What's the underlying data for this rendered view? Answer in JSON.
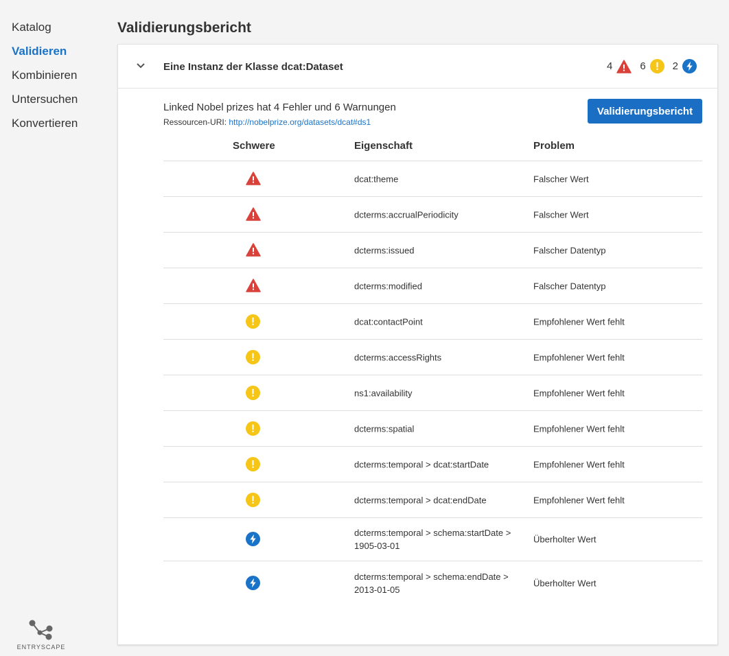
{
  "sidebar": {
    "items": [
      {
        "label": "Katalog"
      },
      {
        "label": "Validieren"
      },
      {
        "label": "Kombinieren"
      },
      {
        "label": "Untersuchen"
      },
      {
        "label": "Konvertieren"
      }
    ],
    "logo_text": "ENTRYSCAPE"
  },
  "page": {
    "title": "Validierungsbericht"
  },
  "card": {
    "title": "Eine Instanz der Klasse dcat:Dataset",
    "counts": {
      "errors": "4",
      "warnings": "6",
      "deprecated": "2"
    },
    "summary": "Linked Nobel prizes hat 4 Fehler und 6 Warnungen",
    "uri_label": "Ressourcen-URI:",
    "uri": "http://nobelprize.org/datasets/dcat#ds1",
    "report_button": "Validierungsbericht"
  },
  "colors": {
    "error": "#d9423a",
    "warning": "#f5c518",
    "deprecated": "#1a73c7",
    "accent": "#1a6fc4"
  },
  "table": {
    "headers": {
      "severity": "Schwere",
      "property": "Eigenschaft",
      "problem": "Problem"
    },
    "rows": [
      {
        "severity": "error-icon",
        "property": "dcat:theme",
        "problem": "Falscher Wert"
      },
      {
        "severity": "error-icon",
        "property": "dcterms:accrualPeriodicity",
        "problem": "Falscher Wert"
      },
      {
        "severity": "error-icon",
        "property": "dcterms:issued",
        "problem": "Falscher Datentyp"
      },
      {
        "severity": "error-icon",
        "property": "dcterms:modified",
        "problem": "Falscher Datentyp"
      },
      {
        "severity": "warning-icon",
        "property": "dcat:contactPoint",
        "problem": "Empfohlener Wert fehlt"
      },
      {
        "severity": "warning-icon",
        "property": "dcterms:accessRights",
        "problem": "Empfohlener Wert fehlt"
      },
      {
        "severity": "warning-icon",
        "property": "ns1:availability",
        "problem": "Empfohlener Wert fehlt"
      },
      {
        "severity": "warning-icon",
        "property": "dcterms:spatial",
        "problem": "Empfohlener Wert fehlt"
      },
      {
        "severity": "warning-icon",
        "property": "dcterms:temporal > dcat:startDate",
        "problem": "Empfohlener Wert fehlt"
      },
      {
        "severity": "warning-icon",
        "property": "dcterms:temporal > dcat:endDate",
        "problem": "Empfohlener Wert fehlt"
      },
      {
        "severity": "deprecated-icon",
        "property": "dcterms:temporal > schema:startDate > 1905-03-01",
        "problem": "Überholter Wert"
      },
      {
        "severity": "deprecated-icon",
        "property": "dcterms:temporal > schema:endDate > 2013-01-05",
        "problem": "Überholter Wert"
      }
    ]
  }
}
